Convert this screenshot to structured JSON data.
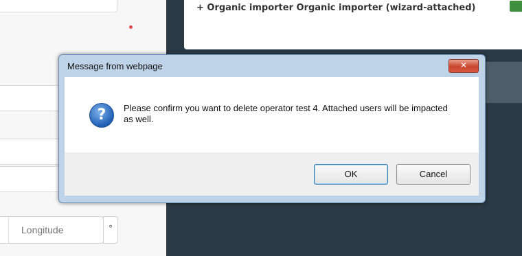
{
  "background_form": {
    "longitude_placeholder": "Longitude",
    "longitude_suffix": "°"
  },
  "background_card": {
    "text": "+ Organic importer Organic importer (wizard-attached)"
  },
  "dialog": {
    "title": "Message from webpage",
    "close_glyph": "✕",
    "icon": "question-icon",
    "message": "Please confirm you want to delete operator test 4. Attached users will be impacted as well.",
    "ok_label": "OK",
    "cancel_label": "Cancel"
  },
  "colors": {
    "page_background": "#2b3a45",
    "dialog_frame": "#bed3e8",
    "close_button": "#c9452c",
    "question_icon": "#1f5fb4"
  }
}
